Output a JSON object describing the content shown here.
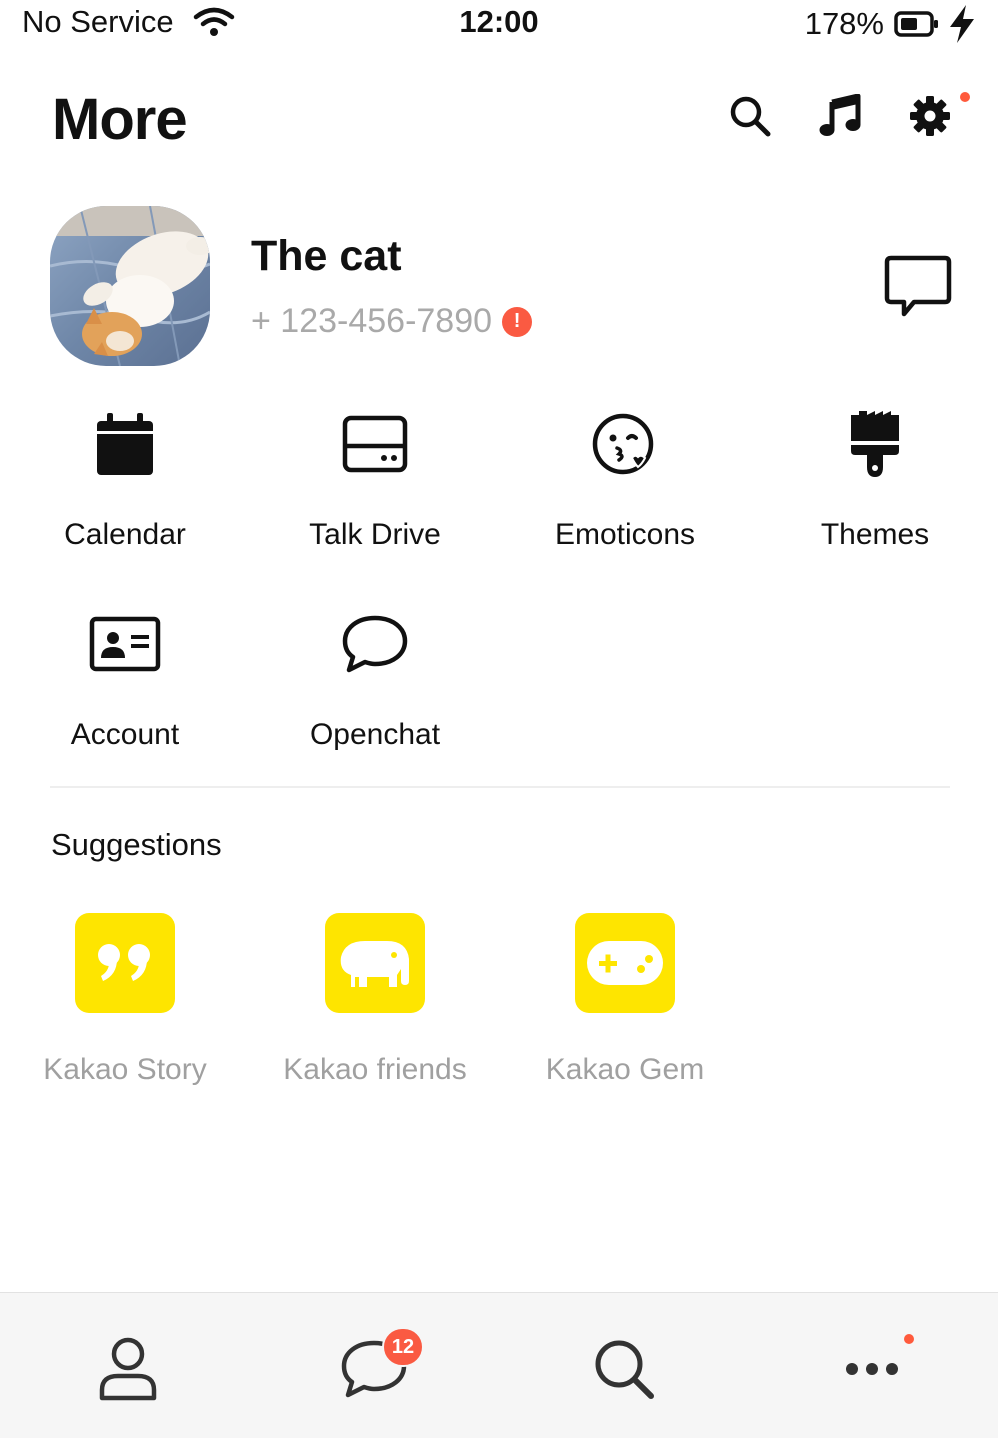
{
  "status_bar": {
    "carrier": "No Service",
    "time": "12:00",
    "battery": "178%"
  },
  "header": {
    "title": "More",
    "icons": [
      "search-icon",
      "music-icon",
      "settings-icon"
    ]
  },
  "profile": {
    "name": "The cat",
    "phone": "+ 123-456-7890",
    "alert": "!"
  },
  "grid": [
    {
      "label": "Calendar",
      "icon": "calendar-icon"
    },
    {
      "label": "Talk Drive",
      "icon": "drive-icon"
    },
    {
      "label": "Emoticons",
      "icon": "emoticon-icon"
    },
    {
      "label": "Themes",
      "icon": "brush-icon"
    },
    {
      "label": "Account",
      "icon": "id-card-icon"
    },
    {
      "label": "Openchat",
      "icon": "speech-bubble-icon"
    }
  ],
  "suggestions": {
    "title": "Suggestions",
    "items": [
      {
        "label": "Kakao Story",
        "icon": "quote-icon"
      },
      {
        "label": "Kakao friends",
        "icon": "elephant-icon"
      },
      {
        "label": "Kakao Gem",
        "icon": "gamepad-icon"
      }
    ]
  },
  "tab_bar": {
    "tabs": [
      "friends-tab",
      "chats-tab",
      "search-tab",
      "more-tab"
    ],
    "chat_badge": "12"
  },
  "colors": {
    "accent_yellow": "#fee500",
    "badge_red": "#fa5a42"
  }
}
